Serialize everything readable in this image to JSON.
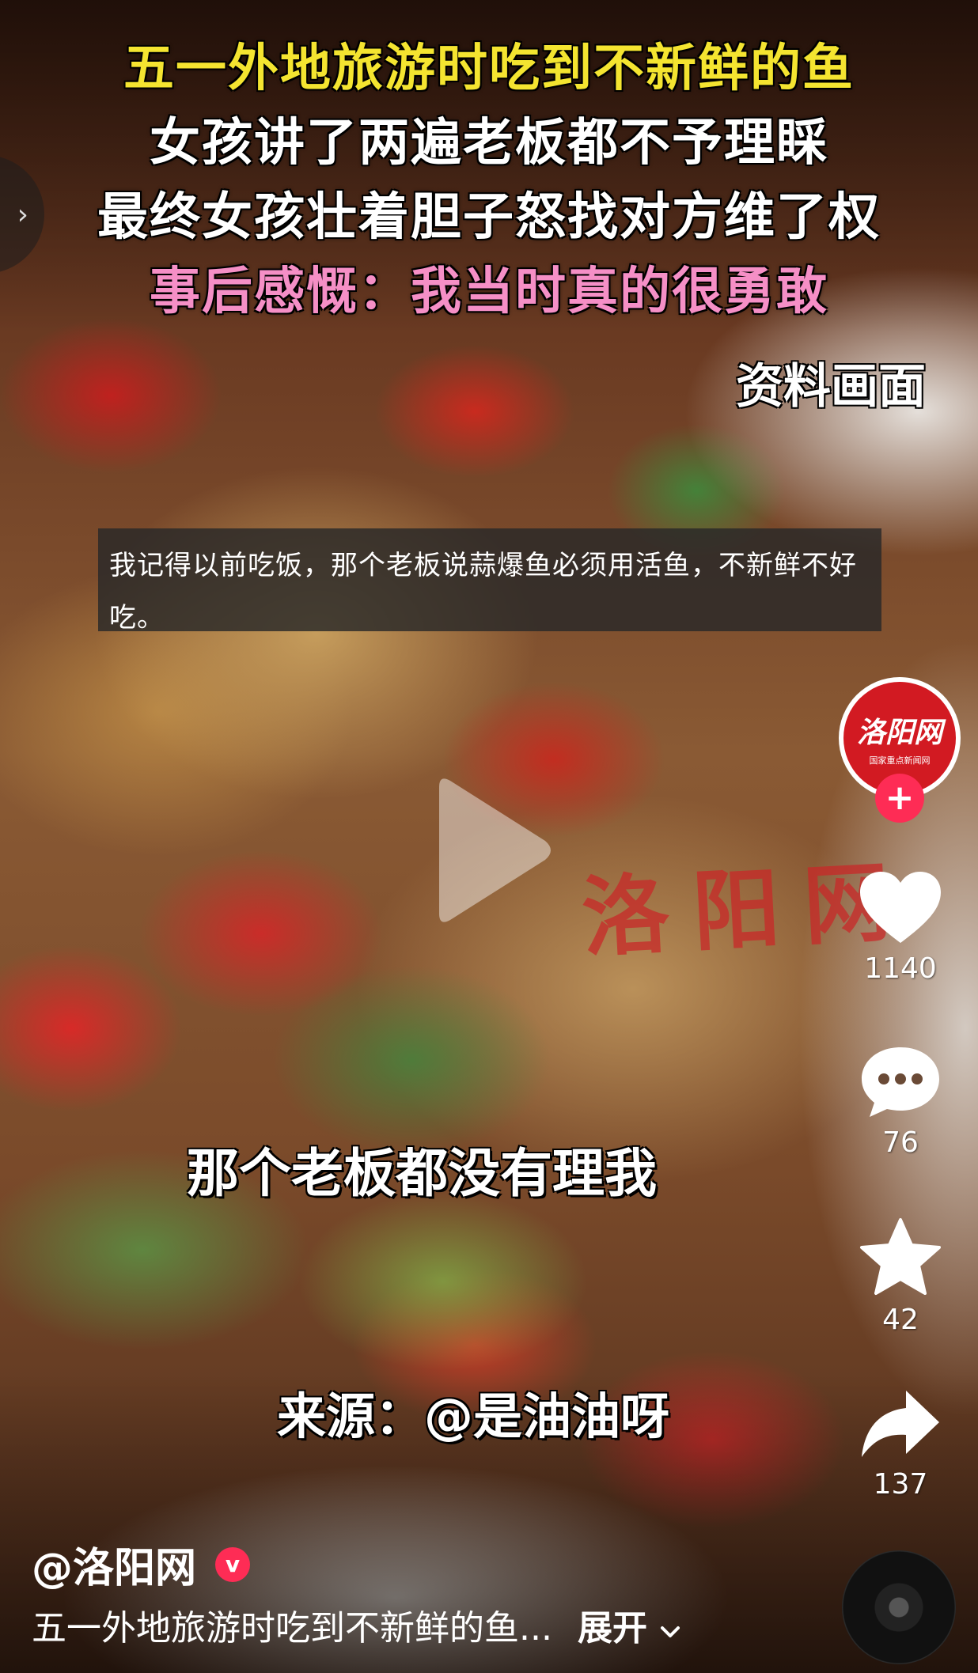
{
  "headline": {
    "line1": "五一外地旅游时吃到不新鲜的鱼",
    "line2": "女孩讲了两遍老板都不予理睬",
    "line3": "最终女孩壮着胆子怒找对方维了权",
    "line4": "事后感慨：我当时真的很勇敢"
  },
  "archive_tag": "资料画面",
  "caption": "我记得以前吃饭，那个老板说蒜爆鱼必须用活鱼，不新鲜不好吃。",
  "watermark": "洛阳网",
  "subtitles": {
    "line1": "那个老板都没有理我",
    "line2": "来源：@是油油呀"
  },
  "avatar": {
    "logo_text": "洛阳网",
    "sub_text": "国家重点新闻网"
  },
  "actions": {
    "like_count": "1140",
    "comment_count": "76",
    "favorite_count": "42",
    "share_count": "137"
  },
  "author": {
    "name": "@洛阳网",
    "verified_mark": "v"
  },
  "description": {
    "text": "五一外地旅游时吃到不新鲜的鱼...",
    "expand_label": "展开"
  },
  "icons": [
    "chevron-right-icon",
    "play-icon",
    "plus-icon",
    "heart-icon",
    "comment-icon",
    "star-icon",
    "share-icon",
    "chevron-down-icon",
    "music-disc-icon"
  ],
  "colors": {
    "accent": "#fe2c55",
    "headline_yellow": "#f4e430",
    "headline_pink": "#f58fc6",
    "brand_red": "#d21a22"
  }
}
